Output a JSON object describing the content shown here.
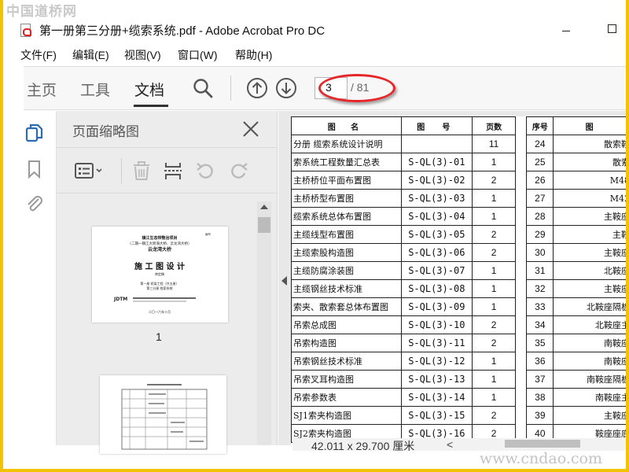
{
  "watermark": {
    "top": "中国道桥网",
    "bottom": "www.cndao.com"
  },
  "window": {
    "title": "第一册第三分册+缆索系统.pdf - Adobe Acrobat Pro DC"
  },
  "menu": [
    {
      "label": "文件(F)"
    },
    {
      "label": "编辑(E)"
    },
    {
      "label": "视图(V)"
    },
    {
      "label": "窗口(W)"
    },
    {
      "label": "帮助(H)"
    }
  ],
  "tabs": [
    {
      "label": "主页"
    },
    {
      "label": "工具"
    },
    {
      "label": "文档",
      "active": true
    }
  ],
  "page_nav": {
    "current": "3",
    "total": "/ 81"
  },
  "panel": {
    "title": "页面缩略图"
  },
  "thumbnails": [
    {
      "label": "1",
      "lines": [
        "镇江生态带整治项目",
        "（二期一镇江大跨海大桥、云龙湾大桥）",
        "云龙湾大桥",
        "施 工 图 设 计",
        "审定稿",
        "第一册  桥梁工程（共五册）",
        "第三分册  缆索系统",
        "JDTM",
        "二〇一六年十月"
      ]
    },
    {
      "label": ""
    }
  ],
  "table": {
    "headers": [
      "图  名",
      "图  号",
      "页数",
      "",
      "序号",
      "图"
    ],
    "rows": [
      {
        "name": "分册 缆索系统设计说明",
        "code": "",
        "pages": "11",
        "no": "24",
        "name2": "散索鞍"
      },
      {
        "name": "索系统工程数量汇总表",
        "code": "S-QL(3)-01",
        "pages": "1",
        "no": "25",
        "name2": "散索"
      },
      {
        "name": "主桥桥位平面布置图",
        "code": "S-QL(3)-02",
        "pages": "2",
        "no": "26",
        "name2": "M48"
      },
      {
        "name": "主桥桥型布置图",
        "code": "S-QL(3)-03",
        "pages": "1",
        "no": "27",
        "name2": "M42"
      },
      {
        "name": "缆索系统总体布置图",
        "code": "S-QL(3)-04",
        "pages": "1",
        "no": "28",
        "name2": "主鞍座"
      },
      {
        "name": "主缆线型布置图",
        "code": "S-QL(3)-05",
        "pages": "2",
        "no": "29",
        "name2": "主鞍"
      },
      {
        "name": "主缆索股构造图",
        "code": "S-QL(3)-06",
        "pages": "2",
        "no": "30",
        "name2": "主鞍座"
      },
      {
        "name": "主缆防腐涂装图",
        "code": "S-QL(3)-07",
        "pages": "1",
        "no": "31",
        "name2": "北鞍座"
      },
      {
        "name": "主缆钢丝技术标准",
        "code": "S-QL(3)-08",
        "pages": "1",
        "no": "32",
        "name2": "主鞍座"
      },
      {
        "name": "索夹、散索套总体布置图",
        "code": "S-QL(3)-09",
        "pages": "1",
        "no": "33",
        "name2": "北鞍座隔板"
      },
      {
        "name": "吊索总成图",
        "code": "S-QL(3)-10",
        "pages": "2",
        "no": "34",
        "name2": "北鞍座主"
      },
      {
        "name": "吊索构造图",
        "code": "S-QL(3)-11",
        "pages": "2",
        "no": "35",
        "name2": "南鞍座"
      },
      {
        "name": "吊索钢丝技术标准",
        "code": "S-QL(3)-12",
        "pages": "1",
        "no": "36",
        "name2": "南鞍座"
      },
      {
        "name": "吊索叉耳构造图",
        "code": "S-QL(3)-13",
        "pages": "1",
        "no": "37",
        "name2": "南鞍座隔板"
      },
      {
        "name": "吊索参数表",
        "code": "S-QL(3)-14",
        "pages": "1",
        "no": "38",
        "name2": "南鞍座主"
      },
      {
        "name": "SJ1索夹构造图",
        "code": "S-QL(3)-15",
        "pages": "2",
        "no": "39",
        "name2": "主鞍座"
      },
      {
        "name": "SJ2索夹构造图",
        "code": "S-QL(3)-16",
        "pages": "2",
        "no": "40",
        "name2": "鞍座座底"
      }
    ]
  },
  "status": {
    "dimensions": "42.011 x 29.700 厘米",
    "scroll_arrow": "<"
  },
  "colors": {
    "accent": "#2b6cb0",
    "highlight": "#e6262a",
    "frame": "#f2c300"
  }
}
